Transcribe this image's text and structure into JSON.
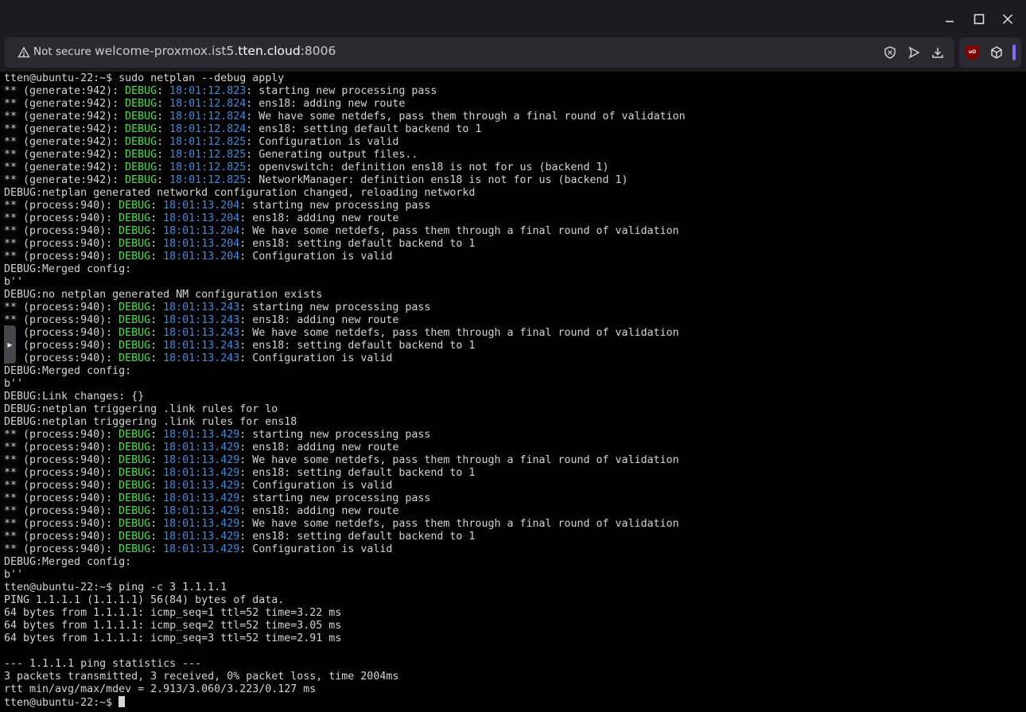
{
  "browser": {
    "security_label": "Not secure",
    "url_prefix": "welcome-proxmox.ist5.",
    "url_domain": "tten.cloud",
    "url_suffix": ":8006"
  },
  "terminal": {
    "lines": [
      [
        [
          "tten@ubuntu-22:~$ sudo netplan --debug apply",
          "n"
        ]
      ],
      [
        [
          "** (generate:942): ",
          "n"
        ],
        [
          "DEBUG",
          "d"
        ],
        [
          ": ",
          "n"
        ],
        [
          "18:01:12.823",
          "t"
        ],
        [
          ": starting new processing pass",
          "n"
        ]
      ],
      [
        [
          "** (generate:942): ",
          "n"
        ],
        [
          "DEBUG",
          "d"
        ],
        [
          ": ",
          "n"
        ],
        [
          "18:01:12.824",
          "t"
        ],
        [
          ": ens18: adding new route",
          "n"
        ]
      ],
      [
        [
          "** (generate:942): ",
          "n"
        ],
        [
          "DEBUG",
          "d"
        ],
        [
          ": ",
          "n"
        ],
        [
          "18:01:12.824",
          "t"
        ],
        [
          ": We have some netdefs, pass them through a final round of validation",
          "n"
        ]
      ],
      [
        [
          "** (generate:942): ",
          "n"
        ],
        [
          "DEBUG",
          "d"
        ],
        [
          ": ",
          "n"
        ],
        [
          "18:01:12.824",
          "t"
        ],
        [
          ": ens18: setting default backend to 1",
          "n"
        ]
      ],
      [
        [
          "** (generate:942): ",
          "n"
        ],
        [
          "DEBUG",
          "d"
        ],
        [
          ": ",
          "n"
        ],
        [
          "18:01:12.825",
          "t"
        ],
        [
          ": Configuration is valid",
          "n"
        ]
      ],
      [
        [
          "** (generate:942): ",
          "n"
        ],
        [
          "DEBUG",
          "d"
        ],
        [
          ": ",
          "n"
        ],
        [
          "18:01:12.825",
          "t"
        ],
        [
          ": Generating output files..",
          "n"
        ]
      ],
      [
        [
          "** (generate:942): ",
          "n"
        ],
        [
          "DEBUG",
          "d"
        ],
        [
          ": ",
          "n"
        ],
        [
          "18:01:12.825",
          "t"
        ],
        [
          ": openvswitch: definition ens18 is not for us (backend 1)",
          "n"
        ]
      ],
      [
        [
          "** (generate:942): ",
          "n"
        ],
        [
          "DEBUG",
          "d"
        ],
        [
          ": ",
          "n"
        ],
        [
          "18:01:12.825",
          "t"
        ],
        [
          ": NetworkManager: definition ens18 is not for us (backend 1)",
          "n"
        ]
      ],
      [
        [
          "DEBUG:netplan generated networkd configuration changed, reloading networkd",
          "n"
        ]
      ],
      [
        [
          "** (process:940): ",
          "n"
        ],
        [
          "DEBUG",
          "d"
        ],
        [
          ": ",
          "n"
        ],
        [
          "18:01:13.204",
          "t"
        ],
        [
          ": starting new processing pass",
          "n"
        ]
      ],
      [
        [
          "** (process:940): ",
          "n"
        ],
        [
          "DEBUG",
          "d"
        ],
        [
          ": ",
          "n"
        ],
        [
          "18:01:13.204",
          "t"
        ],
        [
          ": ens18: adding new route",
          "n"
        ]
      ],
      [
        [
          "** (process:940): ",
          "n"
        ],
        [
          "DEBUG",
          "d"
        ],
        [
          ": ",
          "n"
        ],
        [
          "18:01:13.204",
          "t"
        ],
        [
          ": We have some netdefs, pass them through a final round of validation",
          "n"
        ]
      ],
      [
        [
          "** (process:940): ",
          "n"
        ],
        [
          "DEBUG",
          "d"
        ],
        [
          ": ",
          "n"
        ],
        [
          "18:01:13.204",
          "t"
        ],
        [
          ": ens18: setting default backend to 1",
          "n"
        ]
      ],
      [
        [
          "** (process:940): ",
          "n"
        ],
        [
          "DEBUG",
          "d"
        ],
        [
          ": ",
          "n"
        ],
        [
          "18:01:13.204",
          "t"
        ],
        [
          ": Configuration is valid",
          "n"
        ]
      ],
      [
        [
          "DEBUG:Merged config:",
          "n"
        ]
      ],
      [
        [
          "b''",
          "n"
        ]
      ],
      [
        [
          "DEBUG:no netplan generated NM configuration exists",
          "n"
        ]
      ],
      [
        [
          "** (process:940): ",
          "n"
        ],
        [
          "DEBUG",
          "d"
        ],
        [
          ": ",
          "n"
        ],
        [
          "18:01:13.243",
          "t"
        ],
        [
          ": starting new processing pass",
          "n"
        ]
      ],
      [
        [
          "** (process:940): ",
          "n"
        ],
        [
          "DEBUG",
          "d"
        ],
        [
          ": ",
          "n"
        ],
        [
          "18:01:13.243",
          "t"
        ],
        [
          ": ens18: adding new route",
          "n"
        ]
      ],
      [
        [
          "** (process:940): ",
          "n"
        ],
        [
          "DEBUG",
          "d"
        ],
        [
          ": ",
          "n"
        ],
        [
          "18:01:13.243",
          "t"
        ],
        [
          ": We have some netdefs, pass them through a final round of validation",
          "n"
        ]
      ],
      [
        [
          "** (process:940): ",
          "n"
        ],
        [
          "DEBUG",
          "d"
        ],
        [
          ": ",
          "n"
        ],
        [
          "18:01:13.243",
          "t"
        ],
        [
          ": ens18: setting default backend to 1",
          "n"
        ]
      ],
      [
        [
          "** (process:940): ",
          "n"
        ],
        [
          "DEBUG",
          "d"
        ],
        [
          ": ",
          "n"
        ],
        [
          "18:01:13.243",
          "t"
        ],
        [
          ": Configuration is valid",
          "n"
        ]
      ],
      [
        [
          "DEBUG:Merged config:",
          "n"
        ]
      ],
      [
        [
          "b''",
          "n"
        ]
      ],
      [
        [
          "DEBUG:Link changes: {}",
          "n"
        ]
      ],
      [
        [
          "DEBUG:netplan triggering .link rules for lo",
          "n"
        ]
      ],
      [
        [
          "DEBUG:netplan triggering .link rules for ens18",
          "n"
        ]
      ],
      [
        [
          "** (process:940): ",
          "n"
        ],
        [
          "DEBUG",
          "d"
        ],
        [
          ": ",
          "n"
        ],
        [
          "18:01:13.429",
          "t"
        ],
        [
          ": starting new processing pass",
          "n"
        ]
      ],
      [
        [
          "** (process:940): ",
          "n"
        ],
        [
          "DEBUG",
          "d"
        ],
        [
          ": ",
          "n"
        ],
        [
          "18:01:13.429",
          "t"
        ],
        [
          ": ens18: adding new route",
          "n"
        ]
      ],
      [
        [
          "** (process:940): ",
          "n"
        ],
        [
          "DEBUG",
          "d"
        ],
        [
          ": ",
          "n"
        ],
        [
          "18:01:13.429",
          "t"
        ],
        [
          ": We have some netdefs, pass them through a final round of validation",
          "n"
        ]
      ],
      [
        [
          "** (process:940): ",
          "n"
        ],
        [
          "DEBUG",
          "d"
        ],
        [
          ": ",
          "n"
        ],
        [
          "18:01:13.429",
          "t"
        ],
        [
          ": ens18: setting default backend to 1",
          "n"
        ]
      ],
      [
        [
          "** (process:940): ",
          "n"
        ],
        [
          "DEBUG",
          "d"
        ],
        [
          ": ",
          "n"
        ],
        [
          "18:01:13.429",
          "t"
        ],
        [
          ": Configuration is valid",
          "n"
        ]
      ],
      [
        [
          "** (process:940): ",
          "n"
        ],
        [
          "DEBUG",
          "d"
        ],
        [
          ": ",
          "n"
        ],
        [
          "18:01:13.429",
          "t"
        ],
        [
          ": starting new processing pass",
          "n"
        ]
      ],
      [
        [
          "** (process:940): ",
          "n"
        ],
        [
          "DEBUG",
          "d"
        ],
        [
          ": ",
          "n"
        ],
        [
          "18:01:13.429",
          "t"
        ],
        [
          ": ens18: adding new route",
          "n"
        ]
      ],
      [
        [
          "** (process:940): ",
          "n"
        ],
        [
          "DEBUG",
          "d"
        ],
        [
          ": ",
          "n"
        ],
        [
          "18:01:13.429",
          "t"
        ],
        [
          ": We have some netdefs, pass them through a final round of validation",
          "n"
        ]
      ],
      [
        [
          "** (process:940): ",
          "n"
        ],
        [
          "DEBUG",
          "d"
        ],
        [
          ": ",
          "n"
        ],
        [
          "18:01:13.429",
          "t"
        ],
        [
          ": ens18: setting default backend to 1",
          "n"
        ]
      ],
      [
        [
          "** (process:940): ",
          "n"
        ],
        [
          "DEBUG",
          "d"
        ],
        [
          ": ",
          "n"
        ],
        [
          "18:01:13.429",
          "t"
        ],
        [
          ": Configuration is valid",
          "n"
        ]
      ],
      [
        [
          "DEBUG:Merged config:",
          "n"
        ]
      ],
      [
        [
          "b''",
          "n"
        ]
      ],
      [
        [
          "tten@ubuntu-22:~$ ping -c 3 1.1.1.1",
          "n"
        ]
      ],
      [
        [
          "PING 1.1.1.1 (1.1.1.1) 56(84) bytes of data.",
          "n"
        ]
      ],
      [
        [
          "64 bytes from 1.1.1.1: icmp_seq=1 ttl=52 time=3.22 ms",
          "n"
        ]
      ],
      [
        [
          "64 bytes from 1.1.1.1: icmp_seq=2 ttl=52 time=3.05 ms",
          "n"
        ]
      ],
      [
        [
          "64 bytes from 1.1.1.1: icmp_seq=3 ttl=52 time=2.91 ms",
          "n"
        ]
      ],
      [
        [
          "",
          "n"
        ]
      ],
      [
        [
          "--- 1.1.1.1 ping statistics ---",
          "n"
        ]
      ],
      [
        [
          "3 packets transmitted, 3 received, 0% packet loss, time 2004ms",
          "n"
        ]
      ],
      [
        [
          "rtt min/avg/max/mdev = 2.913/3.060/3.223/0.127 ms",
          "n"
        ]
      ],
      [
        [
          "tten@ubuntu-22:~$ ",
          "n"
        ]
      ]
    ]
  },
  "colors": {
    "debug_keyword": "#4be24b",
    "timestamp": "#3c8fe0",
    "text": "#d3d7cf",
    "background": "#000000"
  },
  "icons": {
    "window_controls": [
      "minimize-icon",
      "maximize-icon",
      "close-icon"
    ],
    "url_actions": [
      "shield-icon",
      "send-icon",
      "download-icon"
    ],
    "extensions": [
      "ublock-icon",
      "cube-icon"
    ]
  }
}
